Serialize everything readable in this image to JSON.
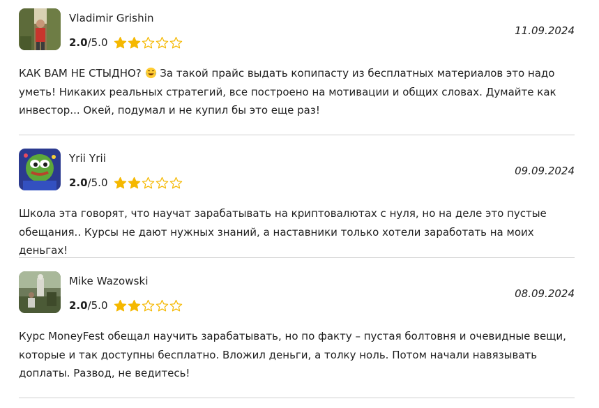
{
  "reviews": [
    {
      "name": "Vladimir Grishin",
      "score": "2.0",
      "max": "/5.0",
      "stars_filled": 2,
      "stars_total": 5,
      "date": "11.09.2024",
      "text_before_emoji": "КАК ВАМ НЕ СТЫДНО? ",
      "emoji": "laughing-with-tears-emoji",
      "text_after_emoji": " За такой прайс выдать копипасту из бесплатных материалов это надо уметь! Никаких реальных стратегий, все построено на мотивации и общих словах. Думайте как инвестор... Окей, подумал и не купил бы это еще раз!"
    },
    {
      "name": "Yrii Yrii",
      "score": "2.0",
      "max": "/5.0",
      "stars_filled": 2,
      "stars_total": 5,
      "date": "09.09.2024",
      "text": "Школа эта говорят, что научат зарабатывать на криптовалютах с нуля, но на деле это пустые обещания.. Курсы не дают нужных знаний, а наставники только хотели заработать на моих деньгах!"
    },
    {
      "name": "Mike Wazowski",
      "score": "2.0",
      "max": "/5.0",
      "stars_filled": 2,
      "stars_total": 5,
      "date": "08.09.2024",
      "text": "Курс MoneyFest обещал научить зарабатывать, но по факту – пустая болтовня и очевидные вещи, которые и так доступны бесплатно. Вложил деньги, а толку ноль. Потом начали навязывать доплаты. Развод, не ведитесь!"
    }
  ],
  "colors": {
    "star_fill": "#f5b800",
    "star_outline": "#f5b800",
    "divider": "#cfcfcf",
    "text": "#1f1f1f"
  }
}
